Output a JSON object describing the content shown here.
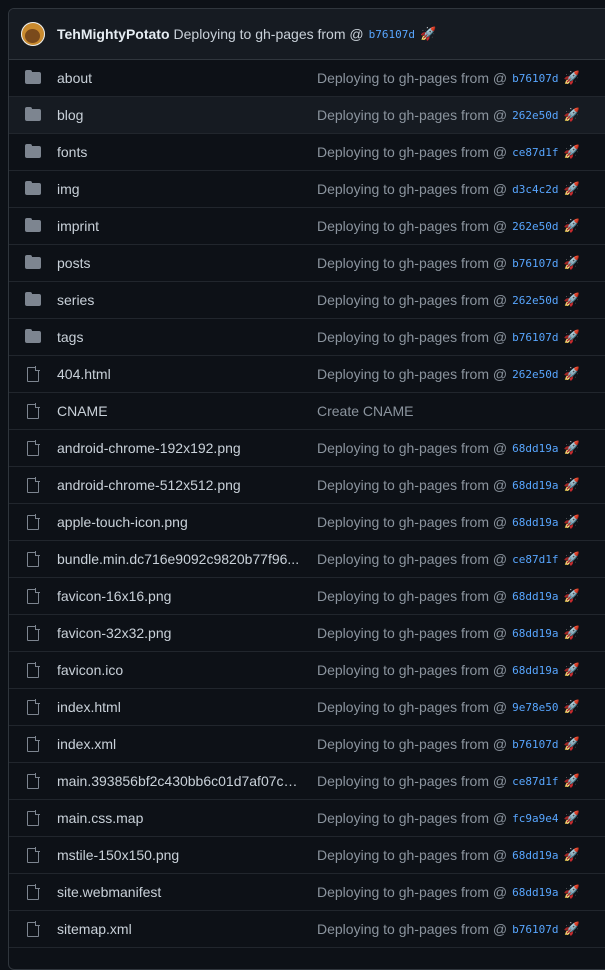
{
  "latest_commit": {
    "author": "TehMightyPotato",
    "message": "Deploying to gh-pages from @",
    "sha": "b76107d",
    "emoji": "🚀"
  },
  "files": [
    {
      "name": "about",
      "type": "folder",
      "message": "Deploying to gh-pages from @",
      "sha": "b76107d",
      "emoji": "🚀"
    },
    {
      "name": "blog",
      "type": "folder",
      "message": "Deploying to gh-pages from @",
      "sha": "262e50d",
      "emoji": "🚀",
      "hover": true
    },
    {
      "name": "fonts",
      "type": "folder",
      "message": "Deploying to gh-pages from @",
      "sha": "ce87d1f",
      "emoji": "🚀"
    },
    {
      "name": "img",
      "type": "folder",
      "message": "Deploying to gh-pages from @",
      "sha": "d3c4c2d",
      "emoji": "🚀"
    },
    {
      "name": "imprint",
      "type": "folder",
      "message": "Deploying to gh-pages from @",
      "sha": "262e50d",
      "emoji": "🚀"
    },
    {
      "name": "posts",
      "type": "folder",
      "message": "Deploying to gh-pages from @",
      "sha": "b76107d",
      "emoji": "🚀"
    },
    {
      "name": "series",
      "type": "folder",
      "message": "Deploying to gh-pages from @",
      "sha": "262e50d",
      "emoji": "🚀"
    },
    {
      "name": "tags",
      "type": "folder",
      "message": "Deploying to gh-pages from @",
      "sha": "b76107d",
      "emoji": "🚀"
    },
    {
      "name": "404.html",
      "type": "file",
      "message": "Deploying to gh-pages from @",
      "sha": "262e50d",
      "emoji": "🚀"
    },
    {
      "name": "CNAME",
      "type": "file",
      "message": "Create CNAME",
      "sha": "",
      "emoji": ""
    },
    {
      "name": "android-chrome-192x192.png",
      "type": "file",
      "message": "Deploying to gh-pages from @",
      "sha": "68dd19a",
      "emoji": "🚀"
    },
    {
      "name": "android-chrome-512x512.png",
      "type": "file",
      "message": "Deploying to gh-pages from @",
      "sha": "68dd19a",
      "emoji": "🚀"
    },
    {
      "name": "apple-touch-icon.png",
      "type": "file",
      "message": "Deploying to gh-pages from @",
      "sha": "68dd19a",
      "emoji": "🚀"
    },
    {
      "name": "bundle.min.dc716e9092c9820b77f96...",
      "type": "file",
      "message": "Deploying to gh-pages from @",
      "sha": "ce87d1f",
      "emoji": "🚀"
    },
    {
      "name": "favicon-16x16.png",
      "type": "file",
      "message": "Deploying to gh-pages from @",
      "sha": "68dd19a",
      "emoji": "🚀"
    },
    {
      "name": "favicon-32x32.png",
      "type": "file",
      "message": "Deploying to gh-pages from @",
      "sha": "68dd19a",
      "emoji": "🚀"
    },
    {
      "name": "favicon.ico",
      "type": "file",
      "message": "Deploying to gh-pages from @",
      "sha": "68dd19a",
      "emoji": "🚀"
    },
    {
      "name": "index.html",
      "type": "file",
      "message": "Deploying to gh-pages from @",
      "sha": "9e78e50",
      "emoji": "🚀"
    },
    {
      "name": "index.xml",
      "type": "file",
      "message": "Deploying to gh-pages from @",
      "sha": "b76107d",
      "emoji": "🚀"
    },
    {
      "name": "main.393856bf2c430bb6c01d7af07c6...",
      "type": "file",
      "message": "Deploying to gh-pages from @",
      "sha": "ce87d1f",
      "emoji": "🚀"
    },
    {
      "name": "main.css.map",
      "type": "file",
      "message": "Deploying to gh-pages from @",
      "sha": "fc9a9e4",
      "emoji": "🚀"
    },
    {
      "name": "mstile-150x150.png",
      "type": "file",
      "message": "Deploying to gh-pages from @",
      "sha": "68dd19a",
      "emoji": "🚀"
    },
    {
      "name": "site.webmanifest",
      "type": "file",
      "message": "Deploying to gh-pages from @",
      "sha": "68dd19a",
      "emoji": "🚀"
    },
    {
      "name": "sitemap.xml",
      "type": "file",
      "message": "Deploying to gh-pages from @",
      "sha": "b76107d",
      "emoji": "🚀"
    }
  ]
}
